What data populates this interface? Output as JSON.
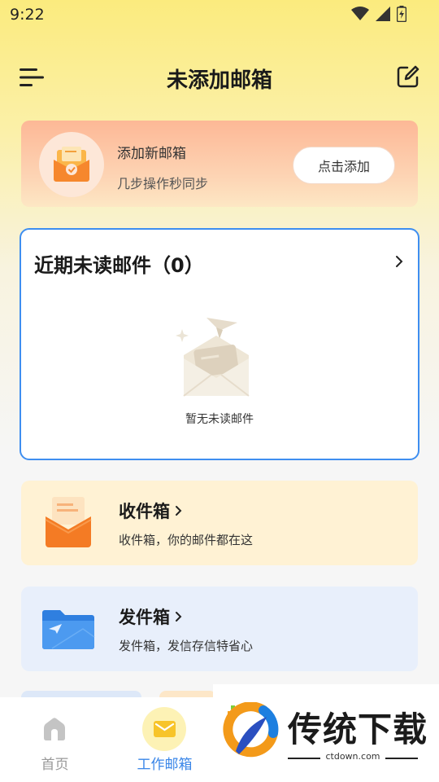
{
  "status_bar": {
    "time": "9:22"
  },
  "header": {
    "title": "未添加邮箱"
  },
  "add_mailbox": {
    "title": "添加新邮箱",
    "subtitle": "几步操作秒同步",
    "button_label": "点击添加"
  },
  "unread": {
    "title": "近期未读邮件（0）",
    "empty_text": "暂无未读邮件"
  },
  "folders": [
    {
      "title": "收件箱",
      "subtitle": "收件箱，你的邮件都在这"
    },
    {
      "title": "发件箱",
      "subtitle": "发件箱，发信存信特省心"
    }
  ],
  "bottom_nav": [
    {
      "label": "首页"
    },
    {
      "label": "工作邮箱",
      "active": true
    }
  ],
  "watermark": {
    "title": "传统下载",
    "url": "ctdown.com"
  },
  "colors": {
    "accent_blue": "#3e8ef0",
    "banner_orange": "#fdb896",
    "inbox_bg": "#fff2d4",
    "sent_bg": "#e8effb"
  }
}
